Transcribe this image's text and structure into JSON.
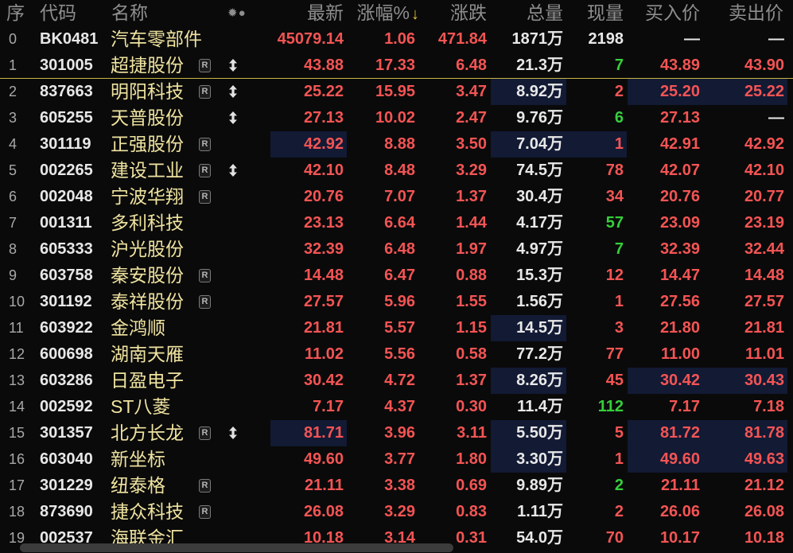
{
  "header": {
    "idx": "序",
    "code": "代码",
    "name": "名称",
    "flags": "✹●",
    "last": "最新",
    "pct": "涨幅%",
    "sort_arrow": "↓",
    "chg": "涨跌",
    "vol": "总量",
    "cur": "现量",
    "bid": "买入价",
    "ask": "卖出价"
  },
  "badge_label": "R",
  "icons": {
    "row_status": "updown-arrow-icon",
    "sort": "sort-descending-arrow-icon"
  },
  "colors": {
    "background": "#0a0a0a",
    "header": "#8e8e8e",
    "sort_arrow": "#e6c23a",
    "index": "#a8a8a8",
    "code": "#e8e8e8",
    "name": "#efe3a0",
    "rise": "#f45454",
    "fall": "#35cf3b",
    "flat": "#e8e8e8",
    "flash_bg": "#121a34",
    "divider": "#c8b545"
  },
  "rows": [
    {
      "idx": "0",
      "code": "BK0481",
      "name": "汽车零部件",
      "badge": false,
      "arrow": false,
      "last": "45079.14",
      "pct": "1.06",
      "chg": "471.84",
      "vol": "1871万",
      "cur": "2198",
      "cur_color": "#e8e8e8",
      "bid": "—",
      "ask": "—",
      "flash": {}
    },
    {
      "idx": "1",
      "code": "301005",
      "name": "超捷股份",
      "badge": true,
      "arrow": true,
      "last": "43.88",
      "pct": "17.33",
      "chg": "6.48",
      "vol": "21.3万",
      "cur": "7",
      "cur_color": "#35cf3b",
      "bid": "43.89",
      "ask": "43.90",
      "flash": {},
      "divider_below": true
    },
    {
      "idx": "2",
      "code": "837663",
      "name": "明阳科技",
      "badge": true,
      "arrow": true,
      "last": "25.22",
      "pct": "15.95",
      "chg": "3.47",
      "vol": "8.92万",
      "cur": "2",
      "cur_color": "#f45454",
      "bid": "25.20",
      "ask": "25.22",
      "flash": {
        "vol": true,
        "bid": true,
        "ask": true
      }
    },
    {
      "idx": "3",
      "code": "605255",
      "name": "天普股份",
      "badge": false,
      "arrow": true,
      "last": "27.13",
      "pct": "10.02",
      "chg": "2.47",
      "vol": "9.76万",
      "cur": "6",
      "cur_color": "#35cf3b",
      "bid": "27.13",
      "ask": "—",
      "flash": {}
    },
    {
      "idx": "4",
      "code": "301119",
      "name": "正强股份",
      "badge": true,
      "arrow": false,
      "last": "42.92",
      "pct": "8.88",
      "chg": "3.50",
      "vol": "7.04万",
      "cur": "1",
      "cur_color": "#f45454",
      "bid": "42.91",
      "ask": "42.92",
      "flash": {
        "last": true,
        "vol": true,
        "cur": true
      }
    },
    {
      "idx": "5",
      "code": "002265",
      "name": "建设工业",
      "badge": true,
      "arrow": true,
      "last": "42.10",
      "pct": "8.48",
      "chg": "3.29",
      "vol": "74.5万",
      "cur": "78",
      "cur_color": "#f45454",
      "bid": "42.07",
      "ask": "42.10",
      "flash": {}
    },
    {
      "idx": "6",
      "code": "002048",
      "name": "宁波华翔",
      "badge": true,
      "arrow": false,
      "last": "20.76",
      "pct": "7.07",
      "chg": "1.37",
      "vol": "30.4万",
      "cur": "34",
      "cur_color": "#f45454",
      "bid": "20.76",
      "ask": "20.77",
      "flash": {}
    },
    {
      "idx": "7",
      "code": "001311",
      "name": "多利科技",
      "badge": false,
      "arrow": false,
      "last": "23.13",
      "pct": "6.64",
      "chg": "1.44",
      "vol": "4.17万",
      "cur": "57",
      "cur_color": "#35cf3b",
      "bid": "23.09",
      "ask": "23.19",
      "flash": {}
    },
    {
      "idx": "8",
      "code": "605333",
      "name": "沪光股份",
      "badge": false,
      "arrow": false,
      "last": "32.39",
      "pct": "6.48",
      "chg": "1.97",
      "vol": "4.97万",
      "cur": "7",
      "cur_color": "#35cf3b",
      "bid": "32.39",
      "ask": "32.44",
      "flash": {}
    },
    {
      "idx": "9",
      "code": "603758",
      "name": "秦安股份",
      "badge": true,
      "arrow": false,
      "last": "14.48",
      "pct": "6.47",
      "chg": "0.88",
      "vol": "15.3万",
      "cur": "12",
      "cur_color": "#f45454",
      "bid": "14.47",
      "ask": "14.48",
      "flash": {}
    },
    {
      "idx": "10",
      "code": "301192",
      "name": "泰祥股份",
      "badge": true,
      "arrow": false,
      "last": "27.57",
      "pct": "5.96",
      "chg": "1.55",
      "vol": "1.56万",
      "cur": "1",
      "cur_color": "#f45454",
      "bid": "27.56",
      "ask": "27.57",
      "flash": {}
    },
    {
      "idx": "11",
      "code": "603922",
      "name": "金鸿顺",
      "badge": false,
      "arrow": false,
      "last": "21.81",
      "pct": "5.57",
      "chg": "1.15",
      "vol": "14.5万",
      "cur": "3",
      "cur_color": "#f45454",
      "bid": "21.80",
      "ask": "21.81",
      "flash": {
        "vol": true
      }
    },
    {
      "idx": "12",
      "code": "600698",
      "name": "湖南天雁",
      "badge": false,
      "arrow": false,
      "last": "11.02",
      "pct": "5.56",
      "chg": "0.58",
      "vol": "77.2万",
      "cur": "77",
      "cur_color": "#f45454",
      "bid": "11.00",
      "ask": "11.01",
      "flash": {}
    },
    {
      "idx": "13",
      "code": "603286",
      "name": "日盈电子",
      "badge": false,
      "arrow": false,
      "last": "30.42",
      "pct": "4.72",
      "chg": "1.37",
      "vol": "8.26万",
      "cur": "45",
      "cur_color": "#f45454",
      "bid": "30.42",
      "ask": "30.43",
      "flash": {
        "vol": true,
        "bid": true,
        "ask": true
      }
    },
    {
      "idx": "14",
      "code": "002592",
      "name": "ST八菱",
      "badge": false,
      "arrow": false,
      "last": "7.17",
      "pct": "4.37",
      "chg": "0.30",
      "vol": "11.4万",
      "cur": "112",
      "cur_color": "#35cf3b",
      "bid": "7.17",
      "ask": "7.18",
      "flash": {}
    },
    {
      "idx": "15",
      "code": "301357",
      "name": "北方长龙",
      "badge": true,
      "arrow": true,
      "last": "81.71",
      "pct": "3.96",
      "chg": "3.11",
      "vol": "5.50万",
      "cur": "5",
      "cur_color": "#f45454",
      "bid": "81.72",
      "ask": "81.78",
      "flash": {
        "last": true,
        "vol": true,
        "bid": true,
        "ask": true
      }
    },
    {
      "idx": "16",
      "code": "603040",
      "name": "新坐标",
      "badge": false,
      "arrow": false,
      "last": "49.60",
      "pct": "3.77",
      "chg": "1.80",
      "vol": "3.30万",
      "cur": "1",
      "cur_color": "#f45454",
      "bid": "49.60",
      "ask": "49.63",
      "flash": {
        "vol": true,
        "bid": true,
        "ask": true
      }
    },
    {
      "idx": "17",
      "code": "301229",
      "name": "纽泰格",
      "badge": true,
      "arrow": false,
      "last": "21.11",
      "pct": "3.38",
      "chg": "0.69",
      "vol": "9.89万",
      "cur": "2",
      "cur_color": "#35cf3b",
      "bid": "21.11",
      "ask": "21.12",
      "flash": {}
    },
    {
      "idx": "18",
      "code": "873690",
      "name": "捷众科技",
      "badge": true,
      "arrow": false,
      "last": "26.08",
      "pct": "3.29",
      "chg": "0.83",
      "vol": "1.11万",
      "cur": "2",
      "cur_color": "#f45454",
      "bid": "26.06",
      "ask": "26.08",
      "flash": {}
    },
    {
      "idx": "19",
      "code": "002537",
      "name": "海联金汇",
      "badge": false,
      "arrow": false,
      "last": "10.18",
      "pct": "3.14",
      "chg": "0.31",
      "vol": "54.0万",
      "cur": "70",
      "cur_color": "#f45454",
      "bid": "10.17",
      "ask": "10.18",
      "flash": {}
    }
  ]
}
